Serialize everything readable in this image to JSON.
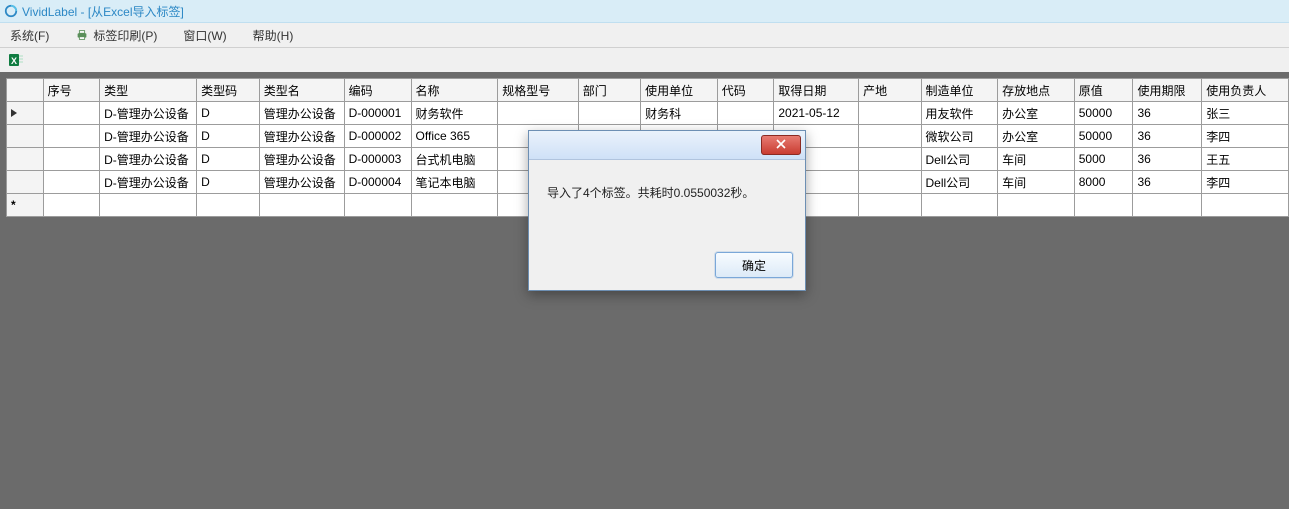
{
  "window": {
    "title": "VividLabel - [从Excel导入标签]"
  },
  "menu": {
    "system": "系统(F)",
    "print": "标签印刷(P)",
    "window": "窗口(W)",
    "help": "帮助(H)"
  },
  "toolbar": {
    "excel_tooltip": "Excel"
  },
  "columns": {
    "seq": "序号",
    "type": "类型",
    "typecode": "类型码",
    "typename": "类型名",
    "code": "编码",
    "name": "名称",
    "spec": "规格型号",
    "dept": "部门",
    "unit": "使用单位",
    "sym": "代码",
    "date": "取得日期",
    "origin": "产地",
    "mfr": "制造单位",
    "store": "存放地点",
    "price": "原值",
    "period": "使用期限",
    "owner": "使用负责人"
  },
  "rows": [
    {
      "seq": "",
      "type": "D-管理办公设备",
      "typecode": "D",
      "typename": "管理办公设备",
      "code": "D-000001",
      "name": "财务软件",
      "spec": "",
      "dept": "",
      "unit": "财务科",
      "sym": "",
      "date": "2021-05-12",
      "origin": "",
      "mfr": "用友软件",
      "store": "办公室",
      "price": "50000",
      "period": "36",
      "owner": "张三",
      "selected": true
    },
    {
      "seq": "",
      "type": "D-管理办公设备",
      "typecode": "D",
      "typename": "管理办公设备",
      "code": "D-000002",
      "name": "Office 365",
      "spec": "",
      "dept": "",
      "unit": "",
      "sym": "",
      "date": "",
      "origin": "",
      "mfr": "微软公司",
      "store": "办公室",
      "price": "50000",
      "period": "36",
      "owner": "李四"
    },
    {
      "seq": "",
      "type": "D-管理办公设备",
      "typecode": "D",
      "typename": "管理办公设备",
      "code": "D-000003",
      "name": "台式机电脑",
      "spec": "",
      "dept": "",
      "unit": "",
      "sym": "",
      "date": "",
      "origin": "",
      "mfr": "Dell公司",
      "store": "车间",
      "price": "5000",
      "period": "36",
      "owner": "王五"
    },
    {
      "seq": "",
      "type": "D-管理办公设备",
      "typecode": "D",
      "typename": "管理办公设备",
      "code": "D-000004",
      "name": "笔记本电脑",
      "spec": "",
      "dept": "",
      "unit": "",
      "sym": "",
      "date": "",
      "origin": "",
      "mfr": "Dell公司",
      "store": "车间",
      "price": "8000",
      "period": "36",
      "owner": "李四"
    }
  ],
  "dialog": {
    "message": "导入了4个标签。共耗时0.0550032秒。",
    "ok": "确定"
  }
}
